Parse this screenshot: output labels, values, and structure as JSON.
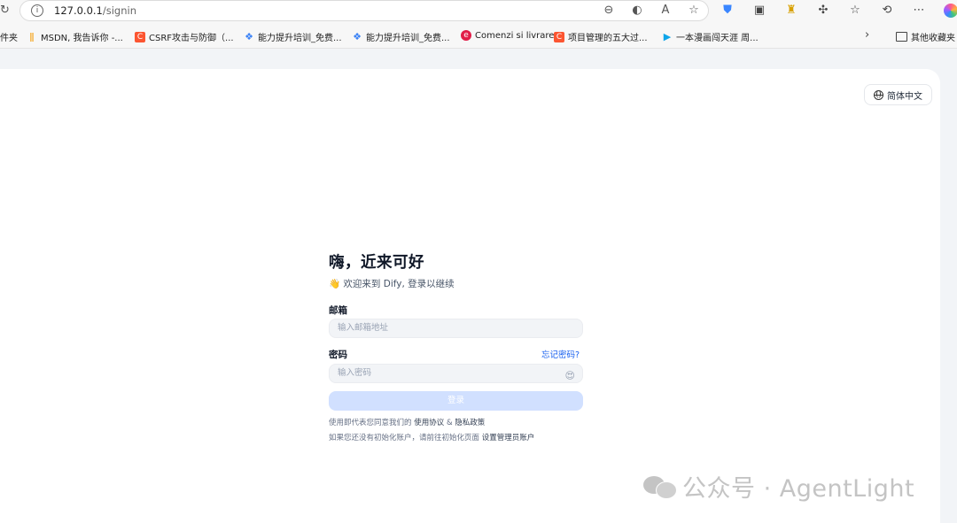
{
  "browser": {
    "url_host": "127.0.0.1",
    "url_path": "/signin",
    "bookmarks": [
      {
        "label": "件夹",
        "icon": "folder-fragment"
      },
      {
        "label": "MSDN, 我告诉你 -...",
        "icon": "msdn-icon"
      },
      {
        "label": "CSRF攻击与防御（...",
        "icon": "csdn-icon"
      },
      {
        "label": "能力提升培训_免费...",
        "icon": "puzzle-icon"
      },
      {
        "label": "能力提升培训_免费...",
        "icon": "puzzle-icon"
      },
      {
        "label": "Comenzi si livrare",
        "icon": "e-icon"
      },
      {
        "label": "项目管理的五大过...",
        "icon": "csdn-icon"
      },
      {
        "label": "一本漫画闯天涯 周...",
        "icon": "play-icon"
      }
    ],
    "other_bookmarks": "其他收藏夹"
  },
  "language": "简体中文",
  "signin": {
    "title": "嗨，近来可好",
    "subtitle": "👋 欢迎来到 Dify, 登录以继续",
    "email_label": "邮箱",
    "email_placeholder": "输入邮箱地址",
    "password_label": "密码",
    "forgot": "忘记密码?",
    "password_placeholder": "输入密码",
    "button": "登录",
    "terms_prefix": "使用即代表您同意我们的",
    "terms_link": "使用协议",
    "terms_and": "&",
    "privacy_link": "隐私政策",
    "init_prefix": "如果您还没有初始化账户，请前往初始化页面",
    "init_link": "设置管理员账户"
  },
  "watermark": "公众号 · AgentLight",
  "colors": {
    "accent": "#155eef",
    "button_disabled": "#d1e0ff",
    "input_bg": "#f2f4f7"
  }
}
